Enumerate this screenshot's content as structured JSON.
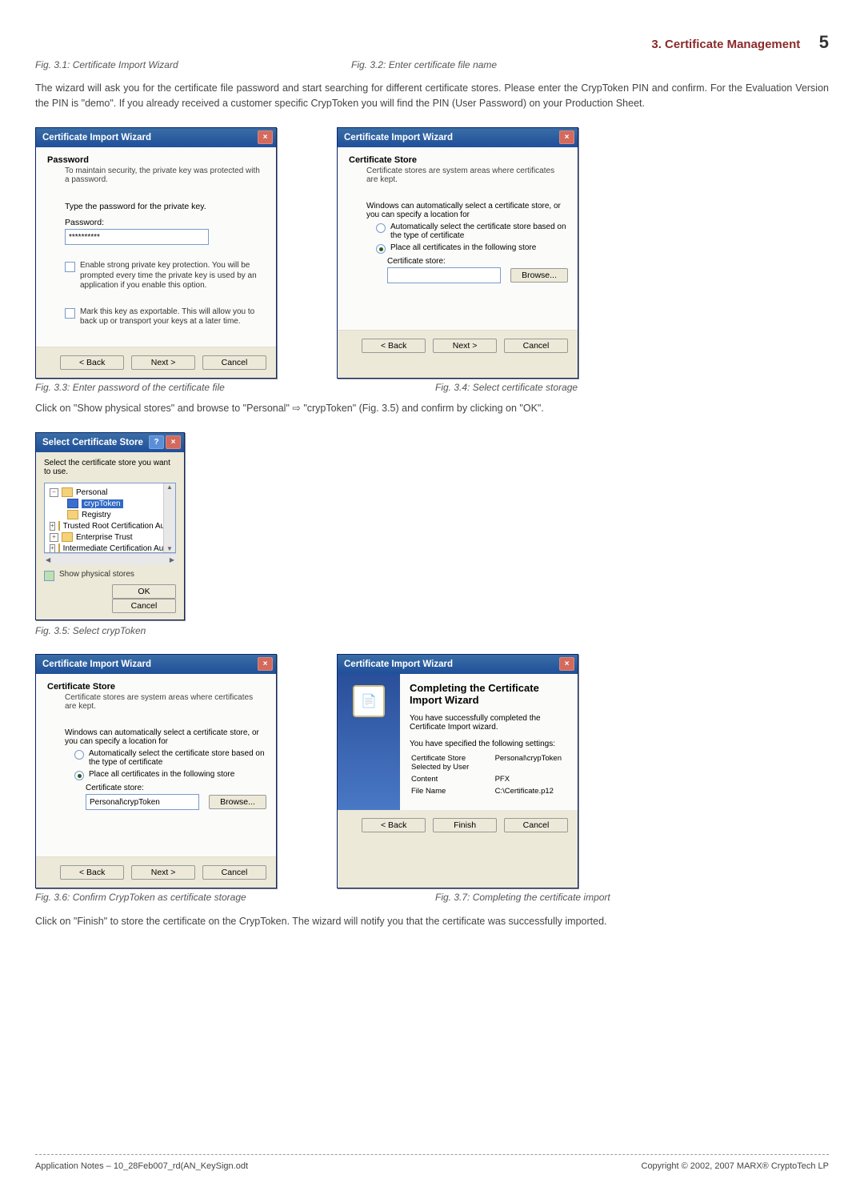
{
  "header": {
    "title": "3. Certificate Management",
    "page_number": "5"
  },
  "captions": {
    "fig31": "Fig. 3.1: Certificate Import Wizard",
    "fig32": "Fig. 3.2: Enter certificate file name",
    "fig33": "Fig. 3.3: Enter password of the certificate file",
    "fig34": "Fig. 3.4: Select certificate storage",
    "fig35": "Fig. 3.5: Select crypToken",
    "fig36": "Fig. 3.6: Confirm CrypToken as certificate storage",
    "fig37": "Fig. 3.7: Completing the certificate import"
  },
  "paragraphs": {
    "p1": "The wizard will ask you for the certificate file password and start searching for different certificate stores. Please enter the CrypToken PIN and confirm. For the Evaluation Version the PIN is \"demo\". If you already received a customer specific CrypToken you will find the PIN (User Password) on your Production Sheet.",
    "p2": "Click on \"Show physical stores\" and browse to \"Personal\" ⇨ \"crypToken\" (Fig. 3.5) and confirm by clicking on \"OK\".",
    "p3": "Click on \"Finish\" to store the certificate on the CrypToken. The wizard will notify you that the certificate was successfully imported."
  },
  "fig33dialog": {
    "title": "Certificate Import Wizard",
    "section": "Password",
    "section_sub": "To maintain security, the private key was protected with a password.",
    "prompt": "Type the password for the private key.",
    "pw_label": "Password:",
    "pw_value": "**********",
    "chk1": "Enable strong private key protection. You will be prompted every time the private key is used by an application if you enable this option.",
    "chk2": "Mark this key as exportable. This will allow you to back up or transport your keys at a later time.",
    "back": "< Back",
    "next": "Next >",
    "cancel": "Cancel"
  },
  "fig34dialog": {
    "title": "Certificate Import Wizard",
    "section": "Certificate Store",
    "section_sub": "Certificate stores are system areas where certificates are kept.",
    "desc": "Windows can automatically select a certificate store, or you can specify a location for",
    "opt1": "Automatically select the certificate store based on the type of certificate",
    "opt2": "Place all certificates in the following store",
    "store_label": "Certificate store:",
    "store_value": "",
    "browse": "Browse...",
    "back": "< Back",
    "next": "Next >",
    "cancel": "Cancel"
  },
  "fig35dialog": {
    "title": "Select Certificate Store",
    "prompt": "Select the certificate store you want to use.",
    "items": {
      "personal": "Personal",
      "cryptoken": "crypToken",
      "registry": "Registry",
      "trusted": "Trusted Root Certification Authorities",
      "enterprise": "Enterprise Trust",
      "intermediate": "Intermediate Certification Authorities"
    },
    "show_physical": "Show physical stores",
    "ok": "OK",
    "cancel": "Cancel"
  },
  "fig36dialog": {
    "title": "Certificate Import Wizard",
    "section": "Certificate Store",
    "section_sub": "Certificate stores are system areas where certificates are kept.",
    "desc": "Windows can automatically select a certificate store, or you can specify a location for",
    "opt1": "Automatically select the certificate store based on the type of certificate",
    "opt2": "Place all certificates in the following store",
    "store_label": "Certificate store:",
    "store_value": "Personal\\crypToken",
    "browse": "Browse...",
    "back": "< Back",
    "next": "Next >",
    "cancel": "Cancel"
  },
  "fig37dialog": {
    "title": "Certificate Import Wizard",
    "heading": "Completing the Certificate Import Wizard",
    "line1": "You have successfully completed the Certificate Import wizard.",
    "line2": "You have specified the following settings:",
    "rows": [
      [
        "Certificate Store Selected by User",
        "Personal\\crypToken"
      ],
      [
        "Content",
        "PFX"
      ],
      [
        "File Name",
        "C:\\Certificate.p12"
      ]
    ],
    "back": "< Back",
    "finish": "Finish",
    "cancel": "Cancel"
  },
  "footer": {
    "left": "Application Notes – 10_28Feb007_rd(AN_KeySign.odt",
    "right": "Copyright © 2002, 2007 MARX® CryptoTech LP"
  }
}
